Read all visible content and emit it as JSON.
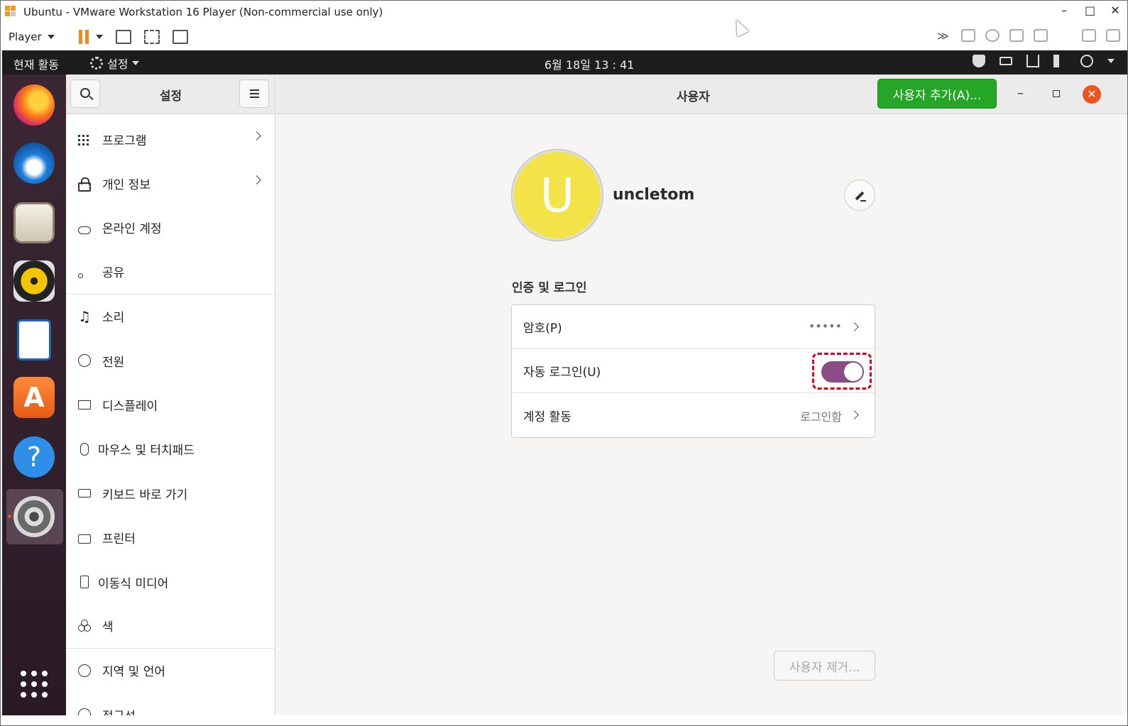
{
  "vm": {
    "title": "Ubuntu - VMware Workstation 16 Player (Non-commercial use only)",
    "player_label": "Player"
  },
  "topbar": {
    "activities": "현재 활동",
    "app_menu": "설정",
    "clock": "6월 18일  13 : 41"
  },
  "dock": {
    "items": [
      "firefox-icon",
      "thunderbird-icon",
      "files-icon",
      "rhythmbox-icon",
      "libreoffice-writer-icon",
      "ubuntu-software-icon",
      "help-icon",
      "settings-icon"
    ],
    "software_glyph": "A",
    "help_glyph": "?"
  },
  "sidebar": {
    "title": "설정",
    "items": [
      {
        "label": "프로그램"
      },
      {
        "label": "개인 정보"
      },
      {
        "label": "온라인 계정"
      },
      {
        "label": "공유"
      },
      {
        "label": "소리"
      },
      {
        "label": "전원"
      },
      {
        "label": "디스플레이"
      },
      {
        "label": "마우스 및 터치패드"
      },
      {
        "label": "키보드 바로 가기"
      },
      {
        "label": "프린터"
      },
      {
        "label": "이동식 미디어"
      },
      {
        "label": "색"
      },
      {
        "label": "지역 및 언어"
      },
      {
        "label": "접근성"
      }
    ]
  },
  "header": {
    "title": "사용자",
    "add_user": "사용자 추가(A)...",
    "minimize": "–",
    "close": "✕"
  },
  "user": {
    "initial": "U",
    "name": "uncletom"
  },
  "auth": {
    "section_title": "인증 및 로그인",
    "password_label": "암호(P)",
    "password_value": "•••••",
    "autologin_label": "자동 로그인(U)",
    "autologin_on": true,
    "activity_label": "계정 활동",
    "activity_value": "로그인함"
  },
  "remove_user": "사용자 제거...",
  "colors": {
    "toggle_on": "#8a4d85",
    "add_button": "#26a626",
    "close_button": "#e95420",
    "avatar": "#f3e349"
  }
}
